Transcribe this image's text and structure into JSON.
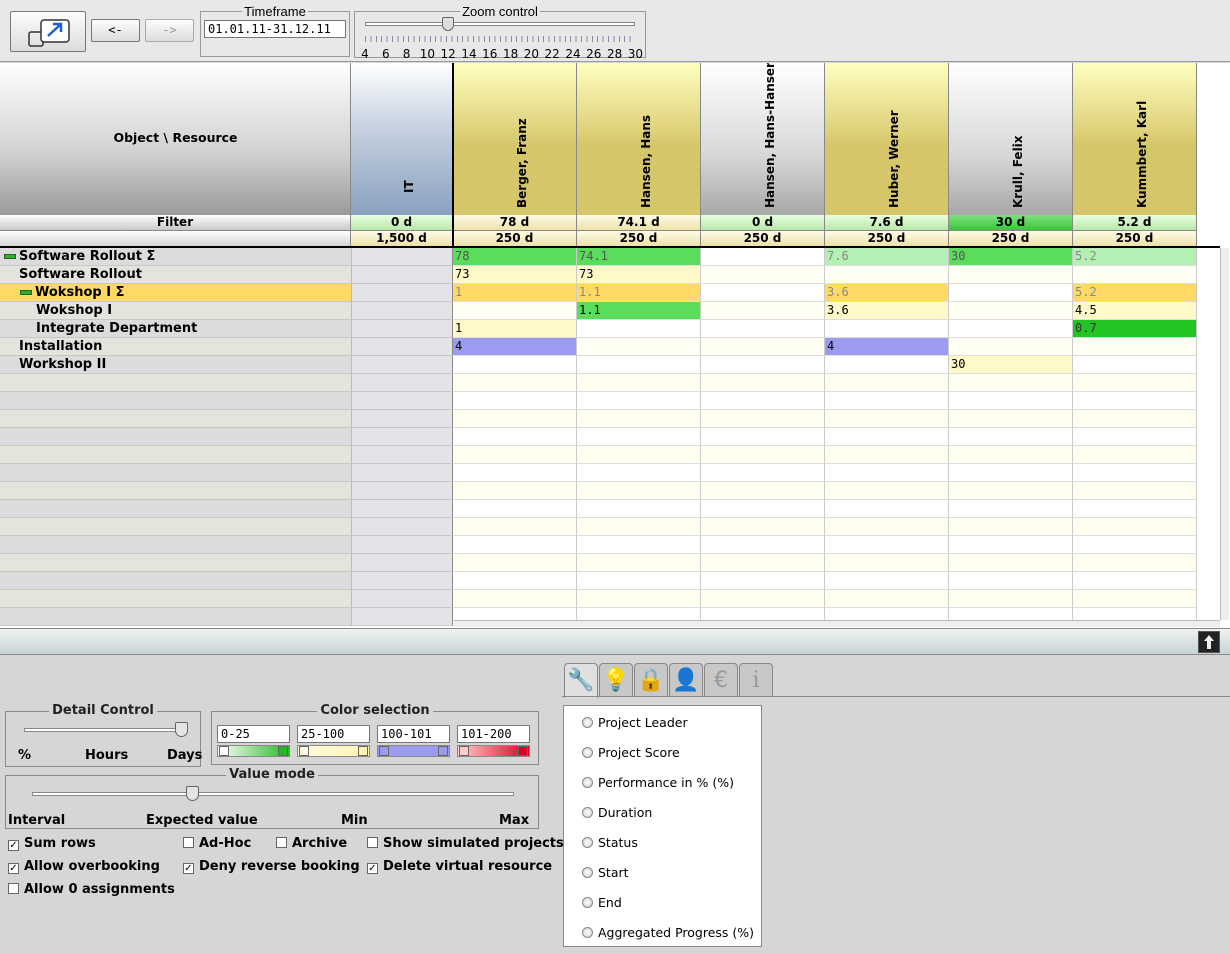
{
  "toolbar": {
    "back_label": "<-",
    "forward_label": "->",
    "timeframe_title": "Timeframe",
    "timeframe_value": "01.01.11-31.12.11",
    "zoom_title": "Zoom control",
    "zoom_ticks": [
      "4",
      "6",
      "8",
      "10",
      "12",
      "14",
      "16",
      "18",
      "20",
      "22",
      "24",
      "26",
      "28",
      "30"
    ],
    "zoom_value": 12
  },
  "grid": {
    "corner_label": "Object \\ Resource",
    "filter_label": "Filter",
    "it": {
      "name": "IT",
      "filter": "0 d",
      "capacity": "1,500 d"
    },
    "resources": [
      {
        "name": "Berger, Franz",
        "filter": "78 d",
        "capacity": "250 d",
        "color": "#d6c66a"
      },
      {
        "name": "Hansen, Hans",
        "filter": "74.1 d",
        "capacity": "250 d",
        "color": "#d6c66a"
      },
      {
        "name": "Hansen, Hans-Hansen",
        "filter": "0 d",
        "capacity": "250 d",
        "color": "#c9c9c9"
      },
      {
        "name": "Huber, Werner",
        "filter": "7.6 d",
        "capacity": "250 d",
        "color": "#d6c66a"
      },
      {
        "name": "Krull, Felix",
        "filter": "30 d",
        "capacity": "250 d",
        "color": "#c9c9c9"
      },
      {
        "name": "Kummbert, Karl",
        "filter": "5.2 d",
        "capacity": "250 d",
        "color": "#d6c66a"
      }
    ],
    "rows": [
      {
        "label": "Software Rollout  Σ",
        "marker": true,
        "indent": 0,
        "style": "sum",
        "cells": [
          "78",
          "74.1",
          "",
          "7.6",
          "30",
          "5.2"
        ]
      },
      {
        "label": "Software Rollout",
        "marker": false,
        "indent": 0,
        "style": "plain",
        "cells": [
          "73",
          "73",
          "",
          "",
          "",
          ""
        ]
      },
      {
        "label": "Wokshop I  Σ",
        "marker": true,
        "indent": 1,
        "style": "subsum",
        "cells": [
          "1",
          "1.1",
          "",
          "3.6",
          "",
          "5.2"
        ]
      },
      {
        "label": "Wokshop I",
        "marker": false,
        "indent": 2,
        "style": "plain",
        "cells": [
          "",
          "1.1",
          "",
          "3.6",
          "",
          "4.5"
        ]
      },
      {
        "label": "Integrate Department",
        "marker": false,
        "indent": 2,
        "style": "plain",
        "cells": [
          "1",
          "",
          "",
          "",
          "",
          "0.7"
        ]
      },
      {
        "label": "Installation",
        "marker": false,
        "indent": 0,
        "style": "plain",
        "cells": [
          "4",
          "",
          "",
          "4",
          "",
          ""
        ]
      },
      {
        "label": "Workshop II",
        "marker": false,
        "indent": 0,
        "style": "plain",
        "cells": [
          "",
          "",
          "",
          "",
          "30",
          ""
        ]
      }
    ]
  },
  "detail_control": {
    "title": "Detail Control",
    "labels": [
      "%",
      "Hours",
      "Days"
    ],
    "selected": "Days"
  },
  "color_selection": {
    "title": "Color selection",
    "ranges": [
      {
        "label": "0-25",
        "from": "#ffffff",
        "to": "#22bb22"
      },
      {
        "label": "25-100",
        "from": "#fffbe0",
        "to": "#fff4b0"
      },
      {
        "label": "100-101",
        "from": "#9b9bef",
        "to": "#9b9bef"
      },
      {
        "label": "101-200",
        "from": "#ffcccc",
        "to": "#dd0022"
      }
    ]
  },
  "value_mode": {
    "title": "Value mode",
    "labels": [
      "Interval",
      "Expected value",
      "Min",
      "Max"
    ],
    "selected": "Expected value"
  },
  "checkboxes": [
    {
      "label": "Sum rows",
      "checked": true
    },
    {
      "label": "Ad-Hoc",
      "checked": false
    },
    {
      "label": "Archive",
      "checked": false
    },
    {
      "label": "Show simulated projects",
      "checked": false
    },
    {
      "label": "Allow overbooking",
      "checked": true
    },
    {
      "label": "Deny reverse booking",
      "checked": true
    },
    {
      "label": "Delete virtual resource",
      "checked": true
    },
    {
      "label": "Allow 0 assignments",
      "checked": false
    }
  ],
  "tabs": [
    {
      "icon": "wrench-icon",
      "glyph": "🔧"
    },
    {
      "icon": "lightbulb-icon",
      "glyph": "💡"
    },
    {
      "icon": "lock-icon",
      "glyph": "🔒"
    },
    {
      "icon": "person-icon",
      "glyph": "👤"
    },
    {
      "icon": "euro-icon",
      "glyph": "€"
    },
    {
      "icon": "info-icon",
      "glyph": "i"
    }
  ],
  "options": [
    "Project Leader",
    "Project Score",
    "Performance in % (%)",
    "Duration",
    "Status",
    "Start",
    "End",
    "Aggregated Progress (%)"
  ]
}
